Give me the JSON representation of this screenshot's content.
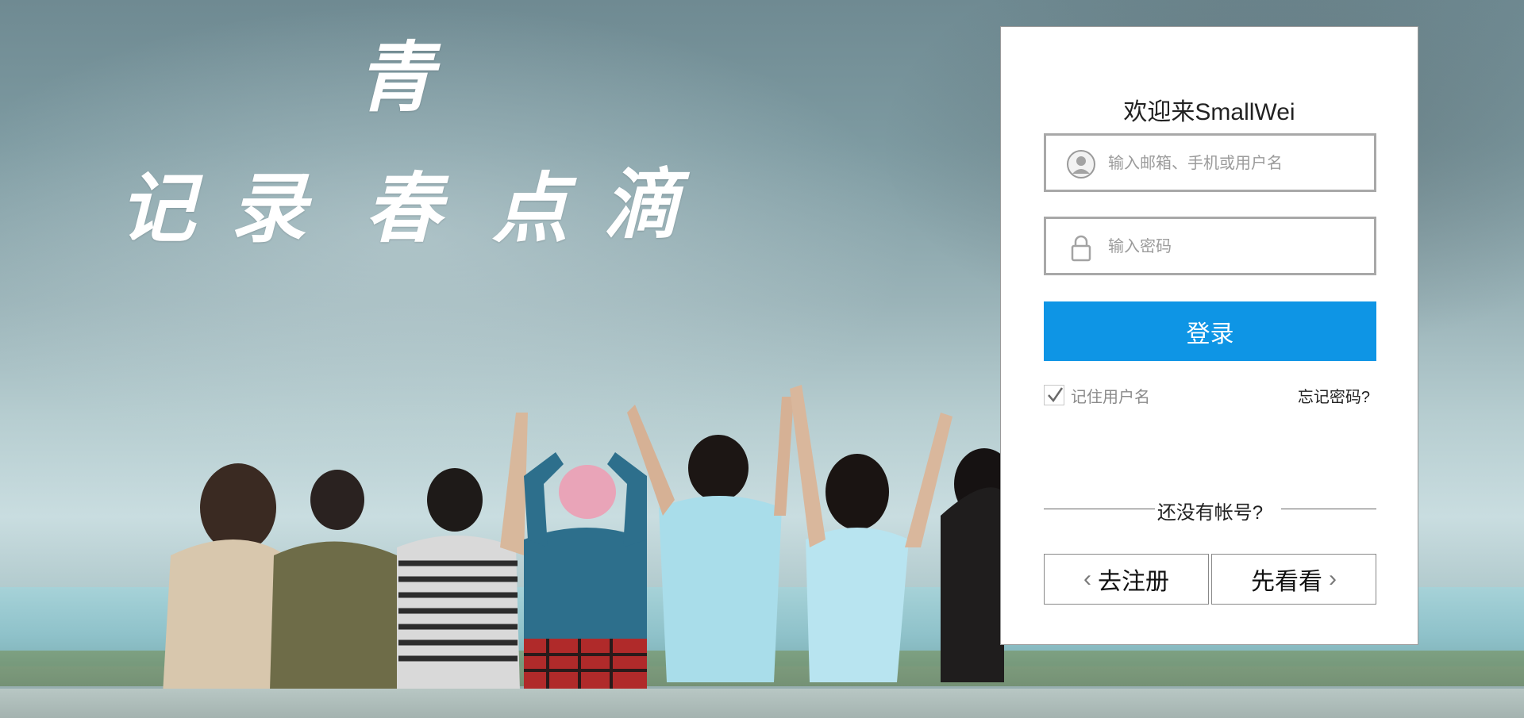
{
  "background": {
    "calligraphy_chars": [
      "青",
      "记",
      "录",
      "春",
      "点",
      "滴"
    ]
  },
  "login": {
    "title": "欢迎来SmallWei",
    "username_placeholder": "输入邮箱、手机或用户名",
    "username_icon": "user-icon",
    "password_placeholder": "输入密码",
    "password_icon": "lock-icon",
    "login_button": "登录",
    "remember_label": "记住用户名",
    "remember_checked": true,
    "forgot_link": "忘记密码?",
    "no_account_text": "还没有帐号?",
    "register_button": "去注册",
    "preview_button": "先看看",
    "accent_color": "#0e95e5"
  }
}
